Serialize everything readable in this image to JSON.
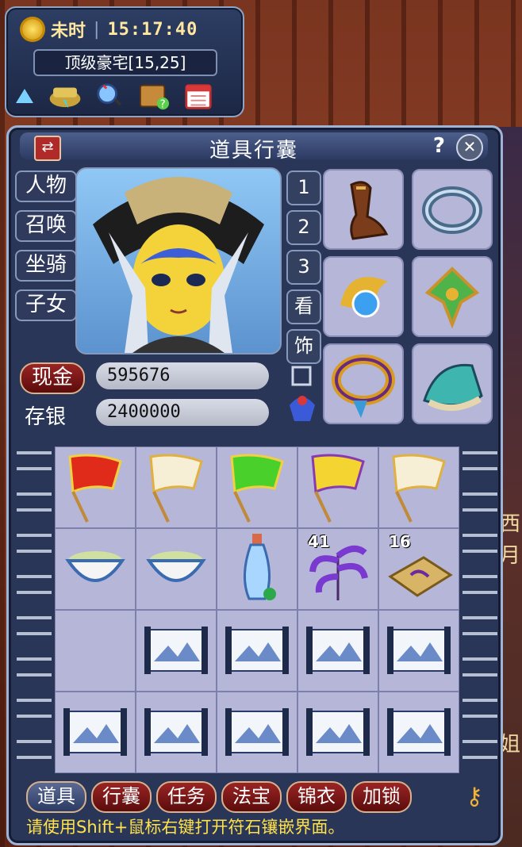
{
  "clock": {
    "time_label": "未时",
    "time": "15:17:40",
    "location": "顶级豪宅[15,25]"
  },
  "background": {
    "right_chars": [
      "西",
      "月",
      "姐"
    ]
  },
  "bag": {
    "title": "道具行囊",
    "help_label": "?",
    "close_label": "✕",
    "swap_label": "⇄",
    "side_tabs": [
      "人物",
      "召唤",
      "坐骑",
      "子女"
    ],
    "page_buttons": [
      "1",
      "2",
      "3",
      "看",
      "饰"
    ],
    "money": {
      "cash_label": "现金",
      "cash_value": "595676",
      "savings_label": "存银",
      "savings_value": "2400000"
    },
    "equipment": [
      "boots-icon",
      "bracelet-icon",
      "orb-icon",
      "jade-pendant-icon",
      "ring-icon",
      "armor-icon"
    ],
    "inventory_counts": {
      "r1c3": "41",
      "r1c4": "16"
    },
    "bottom_tabs": [
      "道具",
      "行囊",
      "任务",
      "法宝",
      "锦衣",
      "加锁"
    ],
    "hint": "请使用Shift+鼠标右键打开符石镶嵌界面。"
  },
  "colors": {
    "panel": "#2a3658",
    "slot": "#b5b6d8",
    "hint": "#ffe24a",
    "tab_red": "#9b2424"
  }
}
